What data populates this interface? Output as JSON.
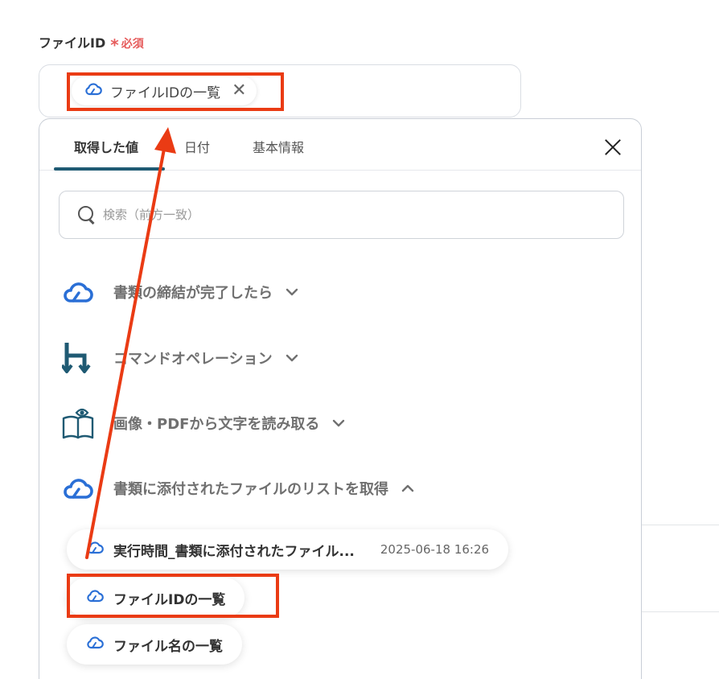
{
  "field": {
    "label": "ファイルID",
    "required_star": "*",
    "required_text": "必須",
    "chip_text": "ファイルIDの一覧",
    "chip_close": "✕"
  },
  "tabs": [
    {
      "label": "取得した値",
      "active": true
    },
    {
      "label": "日付",
      "active": false
    },
    {
      "label": "基本情報",
      "active": false
    }
  ],
  "search": {
    "placeholder": "検索（前方一致）",
    "value": ""
  },
  "groups": [
    {
      "title": "書類の締結が完了したら",
      "icon": "cloud-sign-icon",
      "expanded": false
    },
    {
      "title": "コマンドオペレーション",
      "icon": "command-operation-icon",
      "expanded": false
    },
    {
      "title": "画像・PDFから文字を読み取る",
      "icon": "book-eye-icon",
      "expanded": false
    },
    {
      "title": "書類に添付されたファイルのリストを取得",
      "icon": "cloud-sign-icon",
      "expanded": true
    }
  ],
  "sub_items": [
    {
      "label": "実行時間_書類に添付されたファイル...",
      "time": "2025-06-18 16:26"
    },
    {
      "label": "ファイルIDの一覧",
      "time": ""
    },
    {
      "label": "ファイル名の一覧",
      "time": ""
    }
  ],
  "colors": {
    "accent": "#1f5a73",
    "highlight": "#ea3b14",
    "required": "#e65c5c",
    "cloud_icon": "#2a6fd6"
  }
}
